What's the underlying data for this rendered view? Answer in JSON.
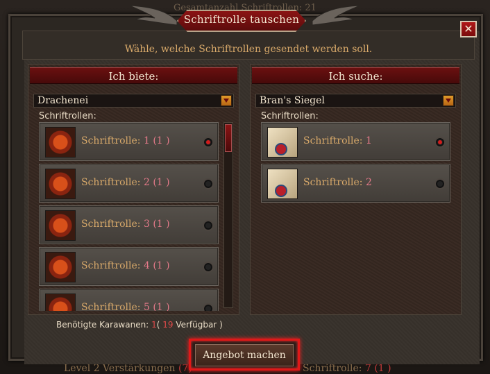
{
  "background": {
    "top_text": "Gesamtanzahl Schriftrollen: 21",
    "bottom_left_label": "Level 2 Verstärkungen",
    "bottom_left_count": "(7)",
    "bottom_right_label": "Schriftrolle:",
    "bottom_right_count": "7 (1 )"
  },
  "dialog": {
    "title": "Schriftrolle tauschen",
    "close_label": "✕",
    "subtitle": "Wähle, welche Schriftrollen gesendet werden soll."
  },
  "offer_panel": {
    "header": "Ich biete:",
    "select_value": "Drachenei",
    "list_label": "Schriftrollen:",
    "items": [
      {
        "label": "Schriftrolle:",
        "value": "1 (1 )",
        "selected": true,
        "icon": "dragon-egg-icon"
      },
      {
        "label": "Schriftrolle:",
        "value": "2 (1 )",
        "selected": false,
        "icon": "dragon-egg-icon"
      },
      {
        "label": "Schriftrolle:",
        "value": "3 (1 )",
        "selected": false,
        "icon": "dragon-egg-icon"
      },
      {
        "label": "Schriftrolle:",
        "value": "4 (1 )",
        "selected": false,
        "icon": "dragon-egg-icon"
      },
      {
        "label": "Schriftrolle:",
        "value": "5 (1 )",
        "selected": false,
        "icon": "dragon-egg-icon"
      }
    ]
  },
  "search_panel": {
    "header": "Ich suche:",
    "select_value": "Bran's Siegel",
    "list_label": "Schriftrollen:",
    "items": [
      {
        "label": "Schriftrolle:",
        "value": "1",
        "selected": true,
        "icon": "sealed-scroll-icon"
      },
      {
        "label": "Schriftrolle:",
        "value": "2",
        "selected": false,
        "icon": "sealed-scroll-icon"
      }
    ]
  },
  "requirement": {
    "label": "Benötigte Karawanen:",
    "needed": "1",
    "open": "(",
    "available": "19",
    "available_label": "Verfügbar",
    "close": ")"
  },
  "offer_button": {
    "label": "Angebot machen"
  },
  "colors": {
    "accent_red": "#8b1414",
    "text_gold": "#d8a96a",
    "value_pink": "#e57a8a",
    "highlight_red": "#e01818"
  }
}
